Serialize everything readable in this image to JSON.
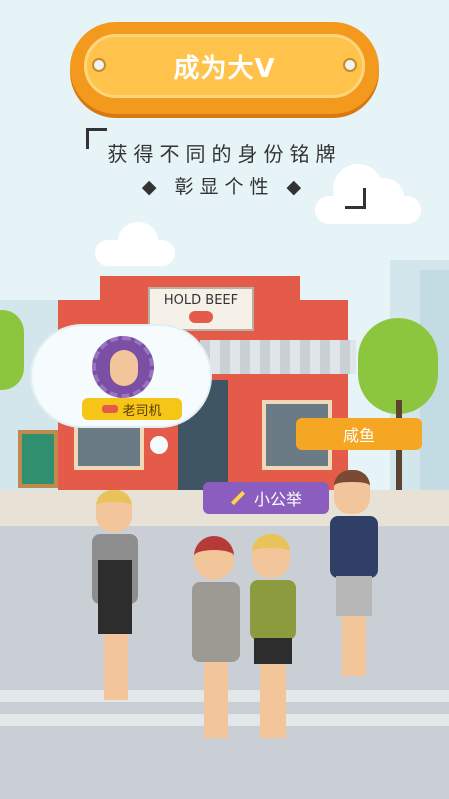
{
  "banner": {
    "title": "成为大V"
  },
  "subtitle": {
    "line1": "获得不同的身份铭牌",
    "line2": "◆ 彰显个性 ◆"
  },
  "shop": {
    "sign": "HOLD BEEF"
  },
  "badges": {
    "old_driver": "老司机",
    "salted_fish": "咸鱼",
    "little_candidate": "小公举"
  },
  "colors": {
    "accent": "#f39a1e",
    "badge_orange": "#f5a623",
    "badge_purple": "#8a5dbf",
    "shop_red": "#e55b4a"
  }
}
